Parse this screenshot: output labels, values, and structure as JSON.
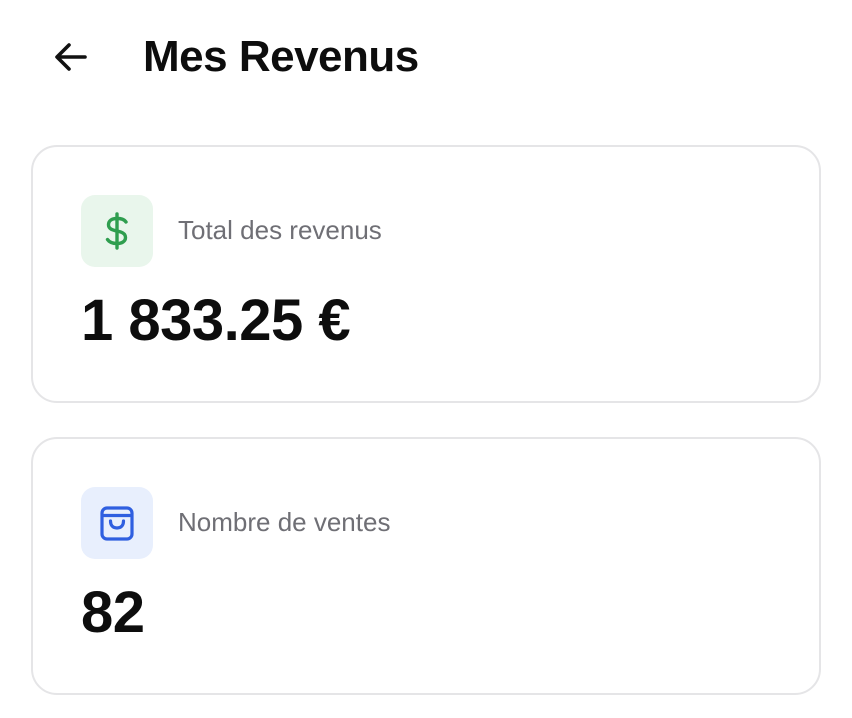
{
  "header": {
    "back_icon": "arrow-left-icon",
    "title": "Mes Revenus"
  },
  "cards": [
    {
      "icon": "dollar-icon",
      "icon_color": "#2f9e4f",
      "icon_bg": "#e9f6ec",
      "label": "Total des revenus",
      "value": "1 833.25 €"
    },
    {
      "icon": "shopping-bag-icon",
      "icon_color": "#2f5fe0",
      "icon_bg": "#e8effd",
      "label": "Nombre de ventes",
      "value": "82"
    }
  ]
}
